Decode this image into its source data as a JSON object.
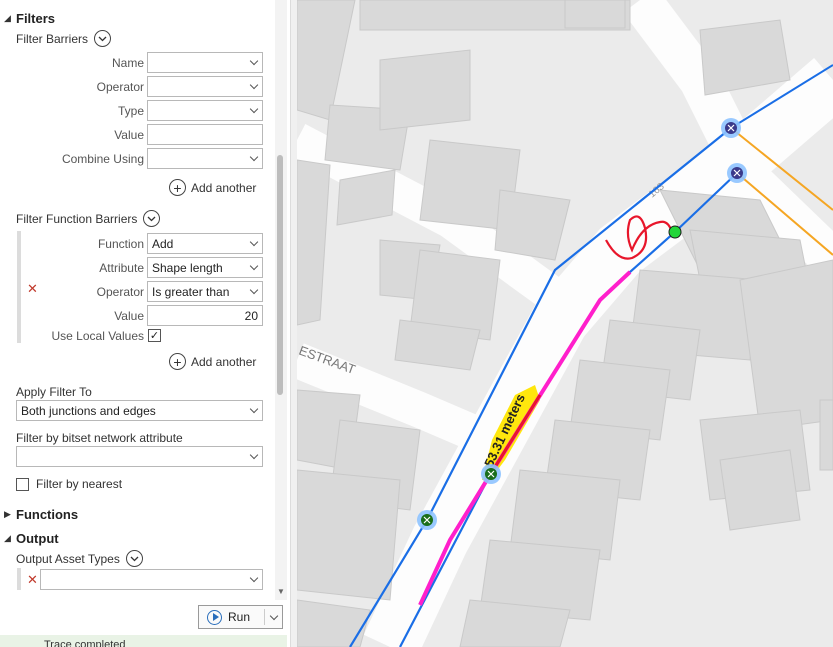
{
  "filters": {
    "title": "Filters",
    "barriers": {
      "title": "Filter Barriers",
      "fields": [
        {
          "label": "Name",
          "value": "",
          "type": "dropdown"
        },
        {
          "label": "Operator",
          "value": "",
          "type": "dropdown"
        },
        {
          "label": "Type",
          "value": "",
          "type": "dropdown"
        },
        {
          "label": "Value",
          "value": "",
          "type": "text"
        },
        {
          "label": "Combine Using",
          "value": "",
          "type": "dropdown"
        }
      ],
      "add_label": "Add another"
    },
    "function_barriers": {
      "title": "Filter Function Barriers",
      "function_label": "Function",
      "function_value": "Add",
      "attribute_label": "Attribute",
      "attribute_value": "Shape length",
      "operator_label": "Operator",
      "operator_value": "Is greater than",
      "value_label": "Value",
      "value_value": "20",
      "local_values_label": "Use Local Values",
      "local_values_checked": true,
      "add_label": "Add another"
    },
    "apply_filter_label": "Apply Filter To",
    "apply_filter_value": "Both junctions and edges",
    "bitset_label": "Filter by bitset network attribute",
    "bitset_value": "",
    "nearest_label": "Filter by nearest",
    "nearest_checked": false
  },
  "functions": {
    "title": "Functions"
  },
  "output": {
    "title": "Output",
    "asset_types_label": "Output Asset Types",
    "asset_types_value": ""
  },
  "run_label": "Run",
  "status_text": "Trace completed",
  "map": {
    "street_label": "ESTRAAT",
    "street_number": "163",
    "measurement_label": "53.31 meters",
    "colors": {
      "blue_line": "#1a6ee6",
      "orange_line": "#f5a623",
      "magenta_line": "#ff1fcb",
      "red_line": "#e8162b",
      "highlight": "#ffe600",
      "junction_green": "#22d63a",
      "building": "#d9d9d9",
      "road": "#fdfdfd",
      "background": "#ebebeb"
    }
  }
}
